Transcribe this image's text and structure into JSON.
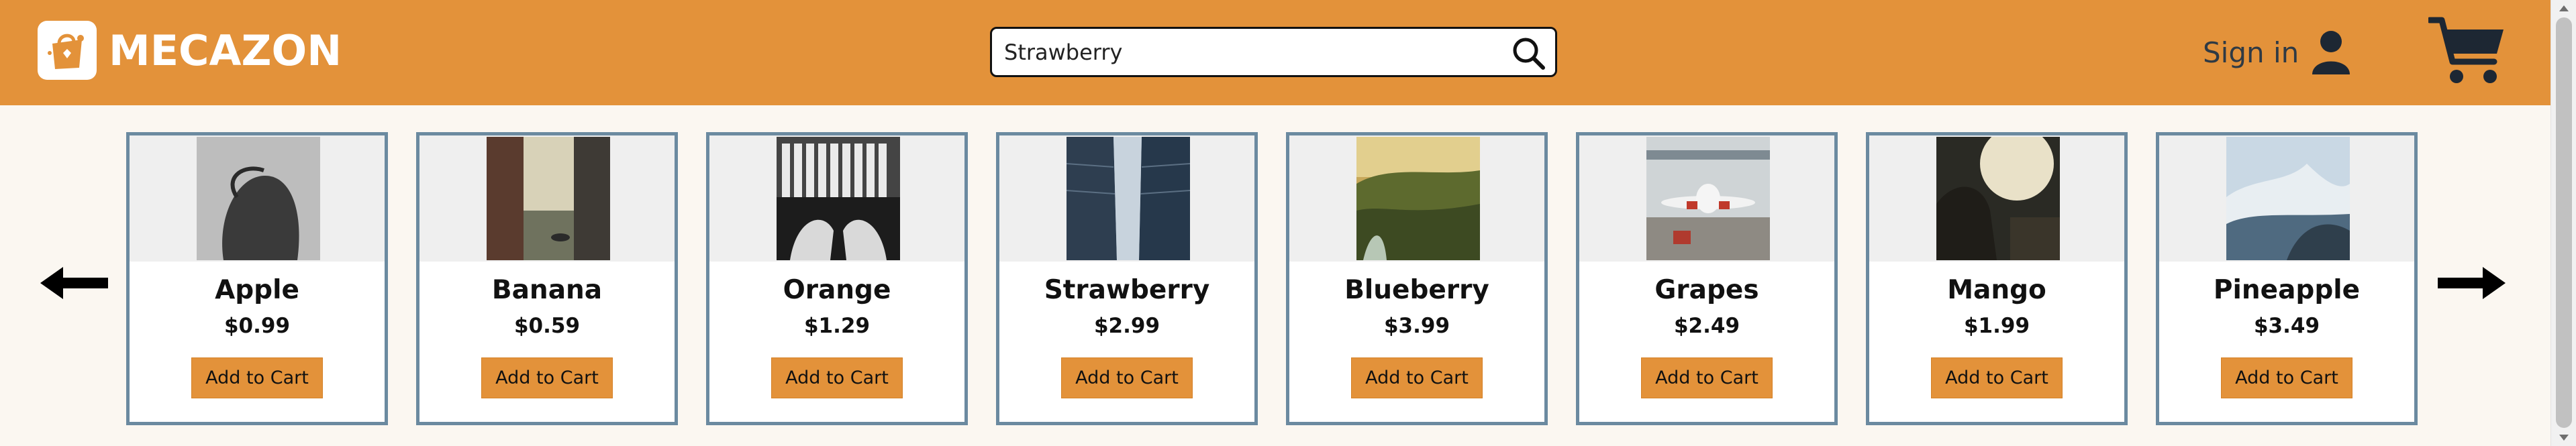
{
  "header": {
    "brand": "MECAZON",
    "logo_icon": "shopping-bag-logo-icon",
    "search_value": "Strawberry",
    "search_icon": "search-icon",
    "signin_label": "Sign in",
    "user_icon": "user-icon",
    "cart_icon": "cart-icon"
  },
  "carousel": {
    "prev_icon": "arrow-left-icon",
    "next_icon": "arrow-right-icon"
  },
  "products": [
    {
      "name": "Apple",
      "price": "$0.99",
      "button": "Add to Cart",
      "image": "silhouette-photo"
    },
    {
      "name": "Banana",
      "price": "$0.59",
      "button": "Add to Cart",
      "image": "canal-photo"
    },
    {
      "name": "Orange",
      "price": "$1.29",
      "button": "Add to Cart",
      "image": "piano-hands-photo"
    },
    {
      "name": "Strawberry",
      "price": "$2.99",
      "button": "Add to Cart",
      "image": "city-street-photo"
    },
    {
      "name": "Blueberry",
      "price": "$3.99",
      "button": "Add to Cart",
      "image": "cliff-landscape-photo"
    },
    {
      "name": "Grapes",
      "price": "$2.49",
      "button": "Add to Cart",
      "image": "airplane-photo"
    },
    {
      "name": "Mango",
      "price": "$1.99",
      "button": "Add to Cart",
      "image": "sunset-person-photo"
    },
    {
      "name": "Pineapple",
      "price": "$3.49",
      "button": "Add to Cart",
      "image": "ocean-wave-photo"
    }
  ],
  "colors": {
    "header": "#e3923a",
    "button": "#e3923a",
    "card_border": "#6b8aa0",
    "page_bg": "#fbf7f1"
  }
}
